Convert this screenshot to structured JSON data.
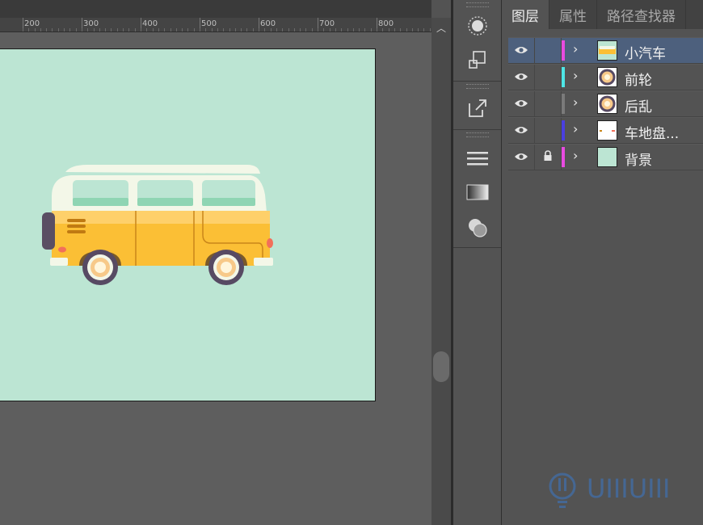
{
  "ruler": {
    "labels": [
      "200",
      "300",
      "400",
      "500",
      "600",
      "700",
      "800"
    ]
  },
  "panel": {
    "tabs": [
      {
        "label": "图层",
        "active": true
      },
      {
        "label": "属性",
        "active": false
      },
      {
        "label": "路径查找器",
        "active": false
      }
    ],
    "layers": [
      {
        "name": "小汽车",
        "color": "#e84be0",
        "selected": true,
        "locked": false,
        "visible": true
      },
      {
        "name": "前轮",
        "color": "#4ee6e6",
        "selected": false,
        "locked": false,
        "visible": true
      },
      {
        "name": "后乱",
        "color": "#7a7a7a",
        "selected": false,
        "locked": false,
        "visible": true
      },
      {
        "name": "车地盘...",
        "color": "#4a3fe0",
        "selected": false,
        "locked": false,
        "visible": true
      },
      {
        "name": "背景",
        "color": "#e84be0",
        "selected": false,
        "locked": true,
        "visible": true
      }
    ]
  },
  "artboard": {
    "background": "#bce5d3"
  },
  "watermark": {
    "text": "UIIIUIII"
  },
  "colors": {
    "selection": "#4d607d",
    "van_yellow": "#f7b52c",
    "van_roof": "#f3f7e8"
  }
}
